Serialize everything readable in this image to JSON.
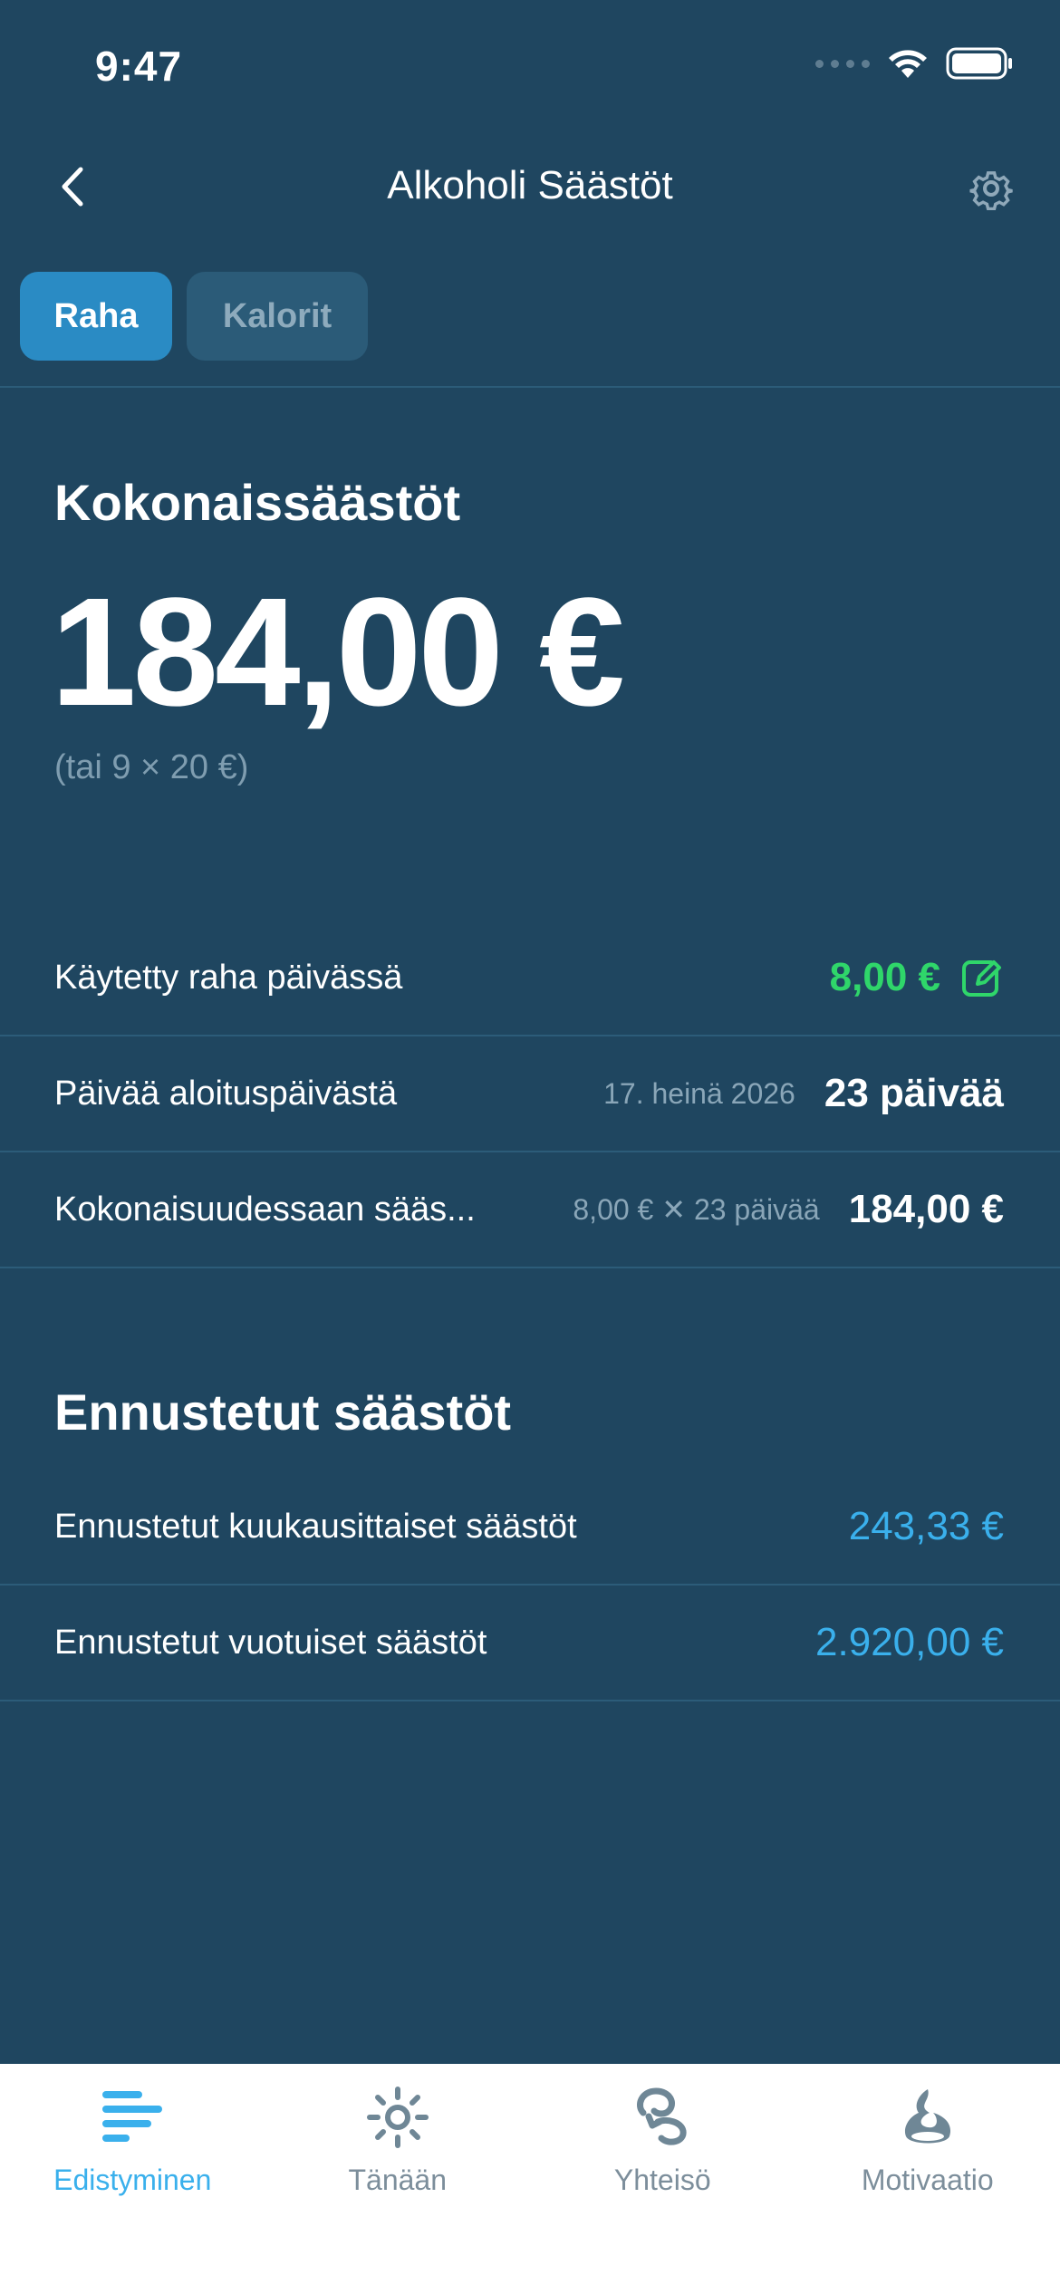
{
  "status": {
    "time": "9:47"
  },
  "nav": {
    "title": "Alkoholi Säästöt"
  },
  "tabs": [
    {
      "label": "Raha",
      "active": true
    },
    {
      "label": "Kalorit",
      "active": false
    }
  ],
  "total": {
    "title": "Kokonaissäästöt",
    "amount": "184,00 €",
    "sub": "(tai 9 × 20 €)"
  },
  "details": {
    "spent": {
      "label": "Käytetty raha päivässä",
      "value": "8,00 €"
    },
    "days": {
      "label": "Päivää aloituspäivästä",
      "meta": "17. heinä 2026",
      "value": "23 päivää"
    },
    "total": {
      "label": "Kokonaisuudessaan sääs...",
      "meta": "8,00 € ✕ 23 päivää",
      "value": "184,00 €"
    }
  },
  "forecast": {
    "title": "Ennustetut säästöt",
    "monthly": {
      "label": "Ennustetut kuukausittaiset säästöt",
      "value": "243,33 €"
    },
    "yearly": {
      "label": "Ennustetut vuotuiset säästöt",
      "value": "2.920,00 €"
    }
  },
  "tabbar": [
    {
      "label": "Edistyminen",
      "icon": "progress-bars-icon",
      "active": true
    },
    {
      "label": "Tänään",
      "icon": "sun-icon",
      "active": false
    },
    {
      "label": "Yhteisö",
      "icon": "community-icon",
      "active": false
    },
    {
      "label": "Motivaatio",
      "icon": "flame-icon",
      "active": false
    }
  ],
  "colors": {
    "background": "#1f4660",
    "accent": "#3ab0ec",
    "active_tab": "#2a8bc4",
    "positive": "#2fd66a"
  }
}
